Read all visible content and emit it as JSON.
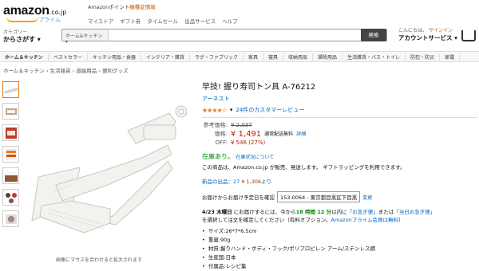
{
  "header": {
    "logo_text": "amazon",
    "logo_tld": ".co.jp",
    "logo_prime": "プライム",
    "promo_prefix": "Amazonポイント",
    "promo_highlight": "機種変情報",
    "nav_links": [
      "マイストア",
      "ギフト券",
      "タイムセール",
      "出品サービス",
      "ヘルプ"
    ],
    "category_small": "カテゴリー",
    "category_big": "からさがす",
    "search_category": "ホーム&キッチン",
    "search_placeholder": "",
    "search_button": "検索",
    "greeting": "こんにちは。",
    "signin": "サインイン",
    "account_services": "アカウントサービス"
  },
  "category_bar": [
    "ホーム＆キッチン",
    "ベストセラー",
    "キッチン用品・食器",
    "インテリア・雑貨",
    "ラグ・ファブリック",
    "家具",
    "寝具",
    "収納用品",
    "掃除用品",
    "生活雑貨・バス・トイレ",
    "防犯・防災",
    "家電"
  ],
  "breadcrumb": "ホーム＆キッチン › 生活雑貨 › 道端用品 › 便利グッズ",
  "thumbnails": [
    "thumb-1",
    "thumb-2",
    "thumb-3",
    "thumb-4",
    "thumb-5",
    "thumb-6",
    "thumb-7"
  ],
  "zoom_hint": "画像にマウスを合わせると拡大されます",
  "product": {
    "title": "早技! 握り寿司トン具 A-76212",
    "brand": "アーネスト",
    "stars": "★★★★☆",
    "reviews": "24件のカスタマーレビュー",
    "ref_price_label": "参考価格:",
    "ref_price": "¥ 2,037",
    "price_label": "価格:",
    "price": "¥ 1,491",
    "free_shipping": "通常配送無料",
    "detail_link": "詳細",
    "off_label": "OFF:",
    "off_value": "¥ 546 (27%)",
    "stock": "在庫あり。",
    "stock_sub": "在庫状況について",
    "ship_text": "この商品は、Amazon.co.jp が販売、発送します。 ギフトラッピングを利用できます。",
    "ship_link": "Amazon.co.jp",
    "newused_label": "新品の出品：27",
    "newused_price": "¥ 1,306",
    "newused_suffix": "より",
    "zip_label": "お届けからお届け予定日を確認",
    "zip_value": "153-0064 - 東京都目黒区下目黒",
    "zip_link": "変更",
    "delivery_line1_prefix": "4/23 木曜日",
    "delivery_line1_mid": " にお届けするには、今から",
    "delivery_time": "18 時間 12 分",
    "delivery_line1_suffix": "以内に",
    "delivery_option1": "「お急ぎ便」",
    "delivery_or": "または",
    "delivery_option2": "「当日お急ぎ便」",
    "delivery_line2": "を選択して注文を確定してください（有料オプション。",
    "delivery_prime": "Amazonプライム会員は無料",
    "delivery_end": "）",
    "bullets": [
      "サイズ:26*7*6.5cm",
      "重量:90g",
      "材質:握りハンド・ボディ・フック/ポリプロピレン アーム/ステンレス鋼",
      "生産国:日本",
      "付属品:レシピ集"
    ]
  }
}
